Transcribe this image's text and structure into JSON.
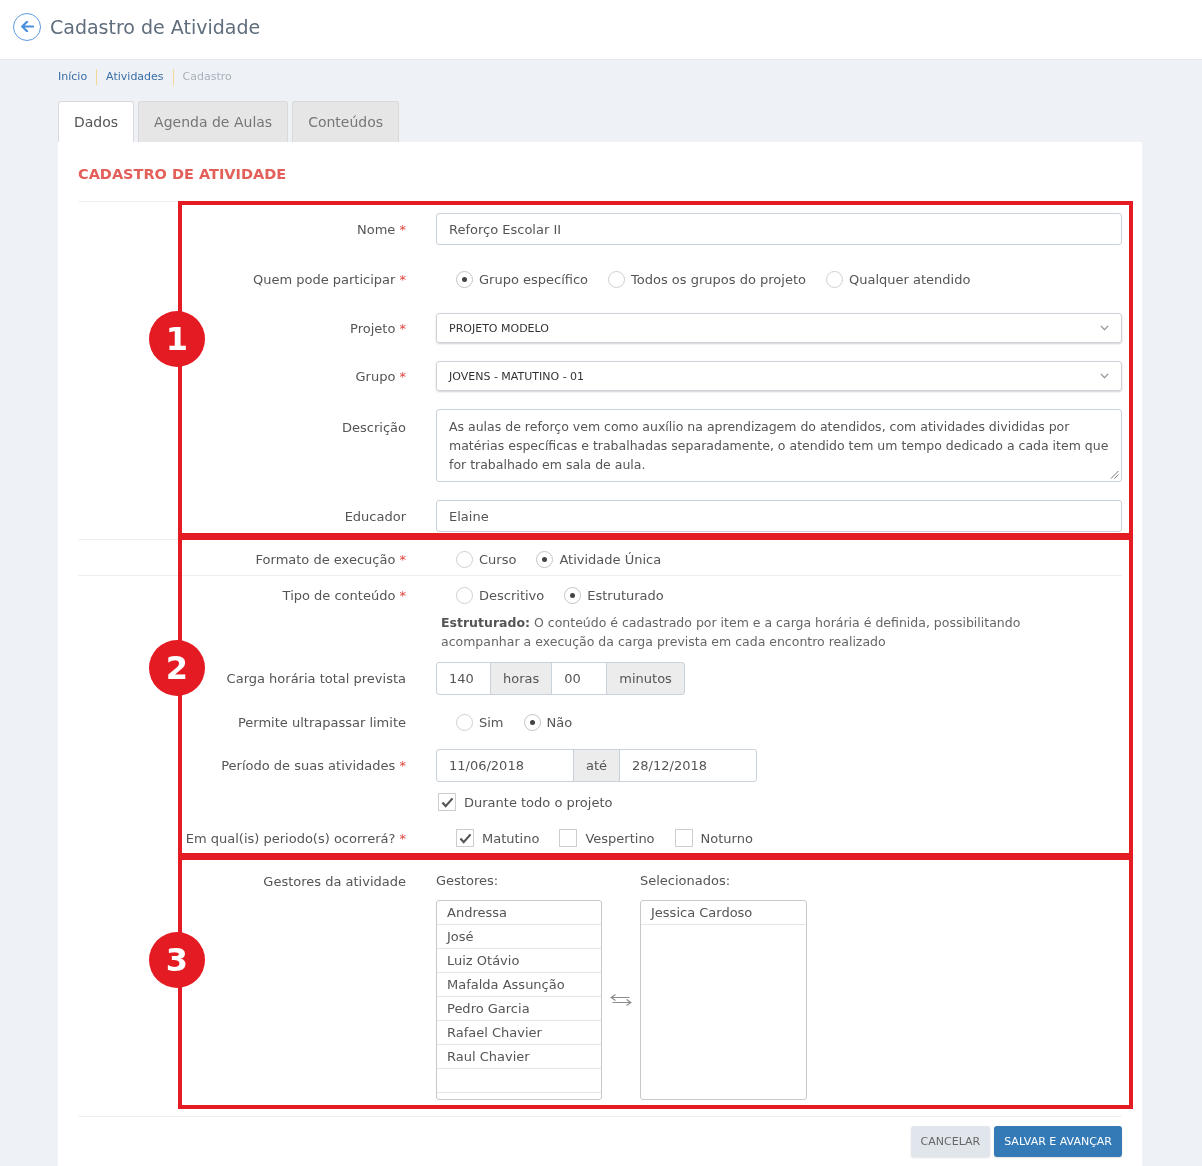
{
  "header": {
    "title": "Cadastro de Atividade"
  },
  "breadcrumb": [
    {
      "label": "Início",
      "current": false
    },
    {
      "label": "Atividades",
      "current": false
    },
    {
      "label": "Cadastro",
      "current": true
    }
  ],
  "tabs": [
    {
      "label": "Dados",
      "selected": true
    },
    {
      "label": "Agenda de Aulas",
      "selected": false
    },
    {
      "label": "Conteúdos",
      "selected": false
    }
  ],
  "form": {
    "title": "CADASTRO DE ATIVIDADE",
    "sections": [
      {
        "annotation": "1",
        "rows": [
          {
            "kind": "text",
            "label": "Nome",
            "required_mark": "*",
            "value": "Reforço Escolar II"
          },
          {
            "kind": "radio",
            "label": "Quem pode participar",
            "required_mark": "*",
            "options": [
              {
                "label": "Grupo específico",
                "selected": true
              },
              {
                "label": "Todos os grupos do projeto",
                "selected": false
              },
              {
                "label": "Qualquer atendido",
                "selected": false
              }
            ]
          },
          {
            "kind": "select",
            "label": "Projeto",
            "required_mark": "*",
            "value": "PROJETO MODELO"
          },
          {
            "kind": "select",
            "label": "Grupo",
            "required_mark": "*",
            "value": "JOVENS - MATUTINO - 01"
          },
          {
            "kind": "textarea",
            "label": "Descrição",
            "value": "As aulas de reforço vem como auxílio na aprendizagem do atendidos, com atividades divididas por matérias específicas e trabalhadas separadamente, o atendido tem um tempo dedicado a cada item que for trabalhado em sala de aula."
          },
          {
            "kind": "text",
            "label": "Educador",
            "value": "Elaine"
          }
        ]
      },
      {
        "annotation": "2",
        "rows": [
          {
            "kind": "divider"
          },
          {
            "kind": "radio",
            "label": "Formato de execução",
            "required_mark": "*",
            "options": [
              {
                "label": "Curso",
                "selected": false
              },
              {
                "label": "Atividade Única",
                "selected": true
              }
            ]
          },
          {
            "kind": "divider"
          },
          {
            "kind": "radio",
            "label": "Tipo de conteúdo",
            "required_mark": "*",
            "options": [
              {
                "label": "Descritivo",
                "selected": false
              },
              {
                "label": "Estruturado",
                "selected": true
              }
            ],
            "help": "**Estruturado:** O conteúdo é cadastrado por item e a carga horária é definida, possibilitando acompanhar a execução da carga prevista em cada encontro realizado"
          },
          {
            "kind": "duration",
            "label": "Carga horária total prevista",
            "hours": "140",
            "hours_unit": "horas",
            "minutes": "00",
            "minutes_unit": "minutos"
          },
          {
            "kind": "radio",
            "label": "Permite ultrapassar limite",
            "options": [
              {
                "label": "Sim",
                "selected": false
              },
              {
                "label": "Não",
                "selected": true
              }
            ]
          },
          {
            "kind": "date_range",
            "label": "Período de suas atividades",
            "required_mark": "*",
            "start": "11/06/2018",
            "separator": "até",
            "end": "28/12/2018"
          },
          {
            "kind": "checkbox",
            "options": [
              {
                "label": "Durante todo o projeto",
                "checked": true
              }
            ]
          },
          {
            "kind": "checkbox_group",
            "label": "Em qual(is) periodo(s) ocorrerá?",
            "required_mark": "*",
            "options": [
              {
                "label": "Matutino",
                "checked": true
              },
              {
                "label": "Vespertino",
                "checked": false
              },
              {
                "label": "Noturno",
                "checked": false
              }
            ]
          }
        ]
      },
      {
        "annotation": "3",
        "rows": [
          {
            "kind": "dual_list",
            "label": "Gestores da atividade",
            "available_title": "Gestores:",
            "available_items": [
              "Andressa",
              "José",
              "Luiz Otávio",
              "Mafalda Assunção",
              "Pedro Garcia",
              "Rafael Chavier",
              "Raul Chavier"
            ],
            "selected_title": "Selecionados:",
            "selected_items": [
              "Jessica Cardoso"
            ]
          }
        ]
      }
    ]
  },
  "buttons": [
    {
      "label": "CANCELAR",
      "kind": "secondary"
    },
    {
      "label": "SALVAR E AVANÇAR",
      "kind": "primary"
    }
  ]
}
